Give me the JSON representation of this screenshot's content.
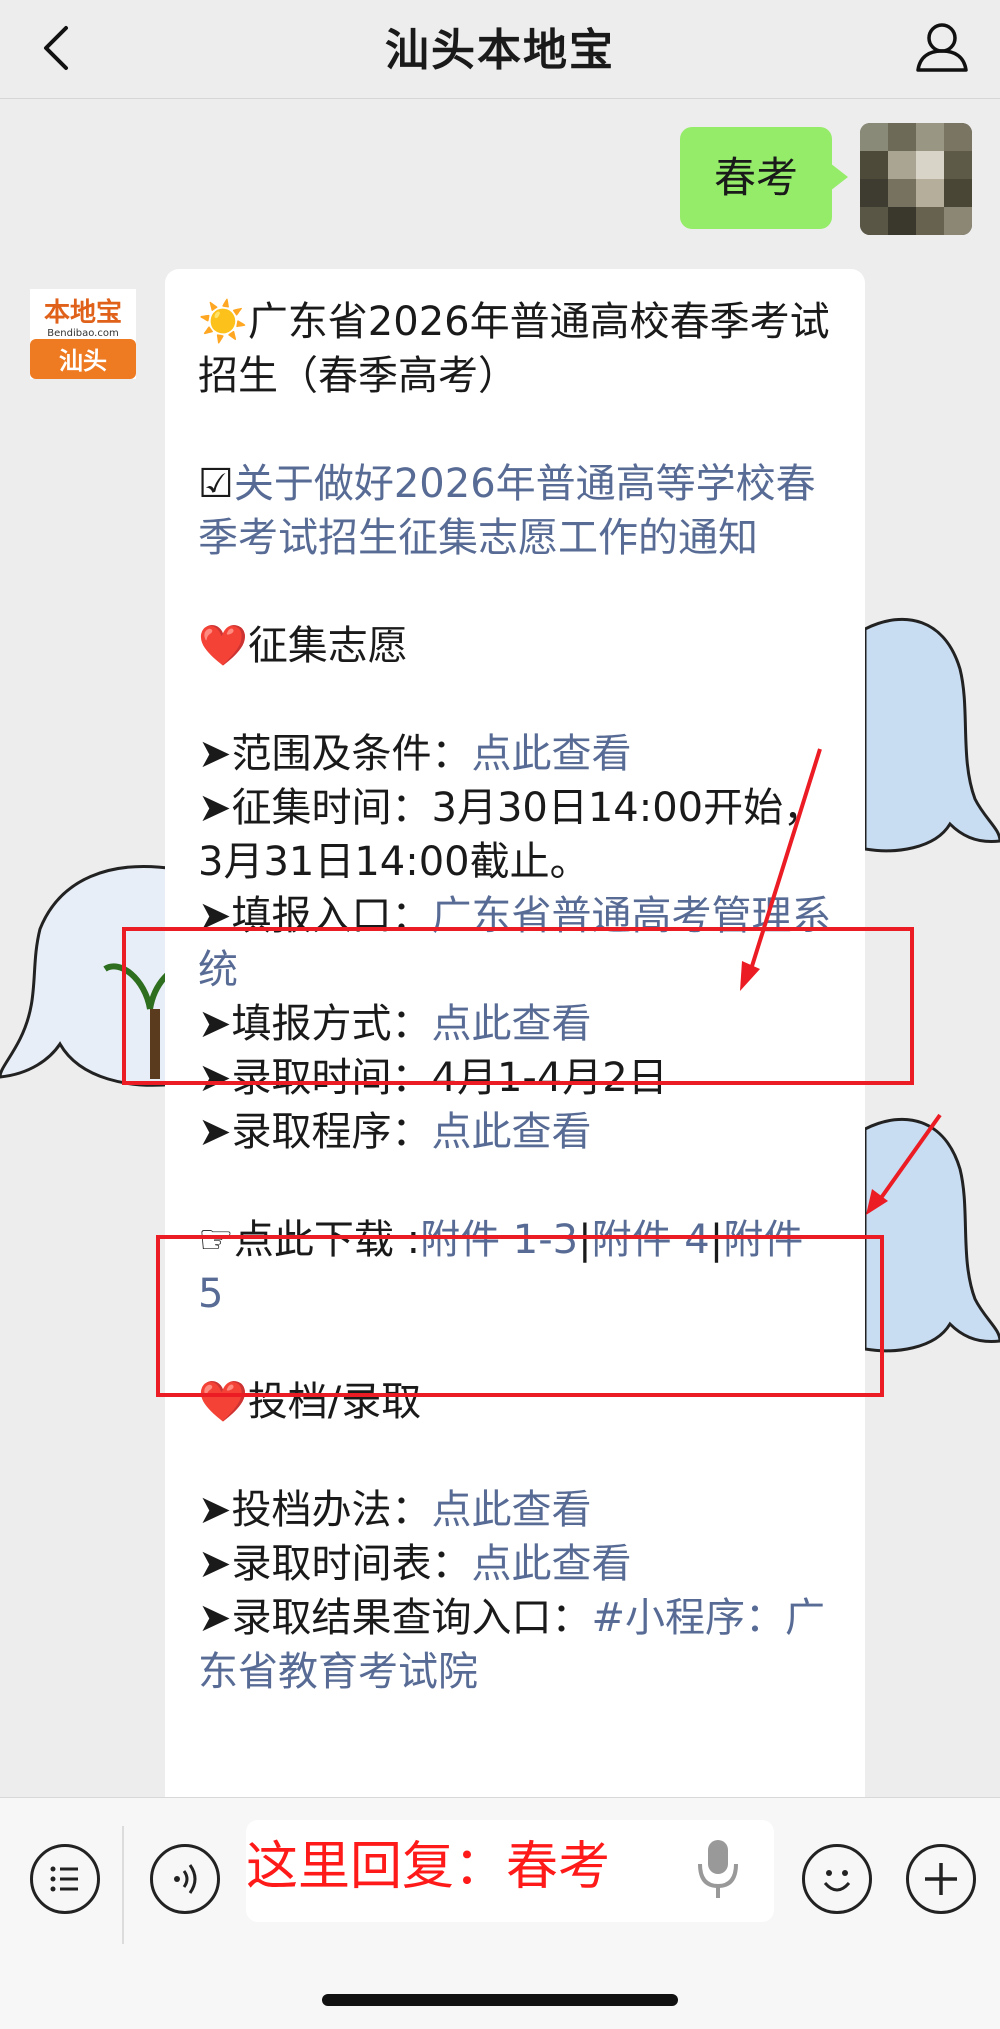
{
  "header": {
    "title": "汕头本地宝"
  },
  "chat": {
    "user_message": "春考",
    "logo": {
      "top": "本地宝",
      "sub": "Bendibao.com",
      "city": "汕头"
    },
    "message": {
      "sun_emoji": "☀️",
      "title": "广东省2026年普通高校春季考试招生（春季高考）",
      "checkbox_emoji": "☑",
      "notice_link": "关于做好2026年普通高等学校春季考试招生征集志愿工作的通知",
      "heart_emoji": "❤️",
      "section1_title": "征集志愿",
      "arrow": "➤",
      "range_label": "范围及条件：",
      "range_link": "点此查看",
      "time_label": "征集时间：",
      "time_value": "3月30日14:00开始，3月31日14:00截止。",
      "entry_label": "填报入口：",
      "entry_link": "广东省普通高考管理系统",
      "method_label": "填报方式：",
      "method_link": "点此查看",
      "admit_time_label": "录取时间：",
      "admit_time_value": "4月1-4月2日",
      "admit_proc_label": "录取程序：",
      "admit_proc_link": "点此查看",
      "download_emoji": "☞",
      "download_label": "点此下载 :",
      "attach1": "附件 1-3",
      "sep": "|",
      "attach2": "附件 4",
      "attach3": "附件 5",
      "section2_title": "投档/录取",
      "toudang_label": "投档办法：",
      "toudang_link": "点此查看",
      "schedule_label": "录取时间表：",
      "schedule_link": "点此查看",
      "result_label": "录取结果查询入口：",
      "result_link": "#小程序：广东省教育考试院"
    }
  },
  "input": {
    "overlay_text": "这里回复：春考"
  },
  "colors": {
    "link": "#576b95",
    "bubble": "#95ec69",
    "annotation_red": "#ec1c24"
  }
}
